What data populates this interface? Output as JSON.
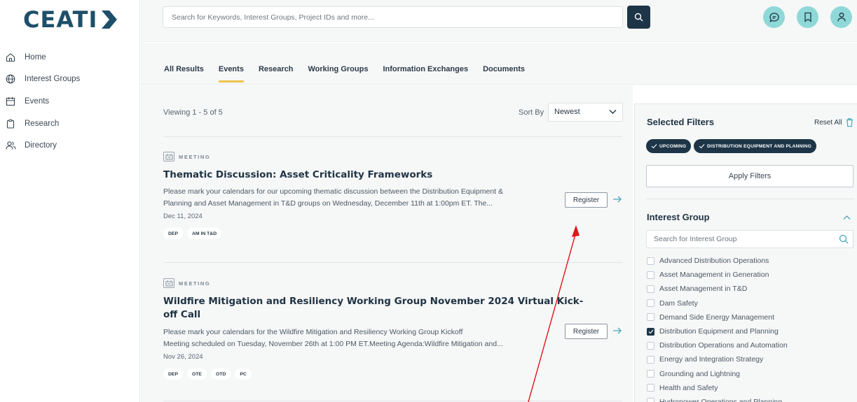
{
  "brand": {
    "logo_text": "CEATI"
  },
  "sidebar": {
    "items": [
      {
        "label": "Home",
        "icon": "home-icon"
      },
      {
        "label": "Interest Groups",
        "icon": "globe-icon"
      },
      {
        "label": "Events",
        "icon": "calendar-icon"
      },
      {
        "label": "Research",
        "icon": "clipboard-icon"
      },
      {
        "label": "Directory",
        "icon": "users-icon"
      }
    ]
  },
  "header": {
    "search_placeholder": "Search for Keywords, Interest Groups, Project IDs and more...",
    "icons": [
      "chat-icon",
      "bookmark-icon",
      "user-icon"
    ]
  },
  "tabs": [
    {
      "label": "All Results",
      "active": false
    },
    {
      "label": "Events",
      "active": true
    },
    {
      "label": "Research",
      "active": false
    },
    {
      "label": "Working Groups",
      "active": false
    },
    {
      "label": "Information Exchanges",
      "active": false
    },
    {
      "label": "Documents",
      "active": false
    }
  ],
  "results": {
    "viewing": "Viewing 1 - 5 of 5",
    "sort_label": "Sort By",
    "sort_value": "Newest"
  },
  "events": [
    {
      "type": "MEETING",
      "title": "Thematic Discussion: Asset Criticality Frameworks",
      "desc_line1": "Please mark your calendars for our upcoming thematic discussion between the Distribution Equipment &",
      "desc_line2": "Planning and Asset Management in T&D groups on Wednesday, December 11th at 1:00pm ET. The...",
      "date": "Dec 11, 2024",
      "tags": [
        "DEP",
        "AM IN T&D"
      ],
      "action": "Register"
    },
    {
      "type": "MEETING",
      "title_line1": "Wildfire Mitigation and Resiliency Working Group November 2024 Virtual Kick-",
      "title_line2": "off Call",
      "desc_line1": "Please mark your calendars for the Wildfire Mitigation and Resiliency Working Group Kickoff",
      "desc_line2": "Meeting scheduled on Tuesday, November 26th at 1:00 PM ET.Meeting Agenda:Wildfire Mitigation and...",
      "date": "Nov 26, 2024",
      "tags": [
        "DEP",
        "OTE",
        "OTD",
        "PC"
      ],
      "action": "Register"
    }
  ],
  "filters": {
    "title": "Selected Filters",
    "reset_label": "Reset All",
    "selected": [
      "UPCOMING",
      "DISTRIBUTION EQUIPMENT AND PLANNING"
    ],
    "apply_label": "Apply Filters",
    "interest_group": {
      "title": "Interest Group",
      "search_placeholder": "Search for Interest Group",
      "options": [
        {
          "label": "Advanced Distribution Operations",
          "checked": false
        },
        {
          "label": "Asset Management in Generation",
          "checked": false
        },
        {
          "label": "Asset Management in T&D",
          "checked": false
        },
        {
          "label": "Dam Safety",
          "checked": false
        },
        {
          "label": "Demand Side Energy Management",
          "checked": false
        },
        {
          "label": "Distribution Equipment and Planning",
          "checked": true
        },
        {
          "label": "Distribution Operations and Automation",
          "checked": false
        },
        {
          "label": "Energy and Integration Strategy",
          "checked": false
        },
        {
          "label": "Grounding and Lightning",
          "checked": false
        },
        {
          "label": "Health and Safety",
          "checked": false
        },
        {
          "label": "Hydropower Operations and Planning",
          "checked": false
        }
      ]
    }
  },
  "colors": {
    "brand": "#1e4f6a",
    "accent_tab": "#f0c24b",
    "dark_button": "#1d3547",
    "avatar_bg": "#8fd8d8",
    "annotation_arrow": "#e0161b"
  }
}
